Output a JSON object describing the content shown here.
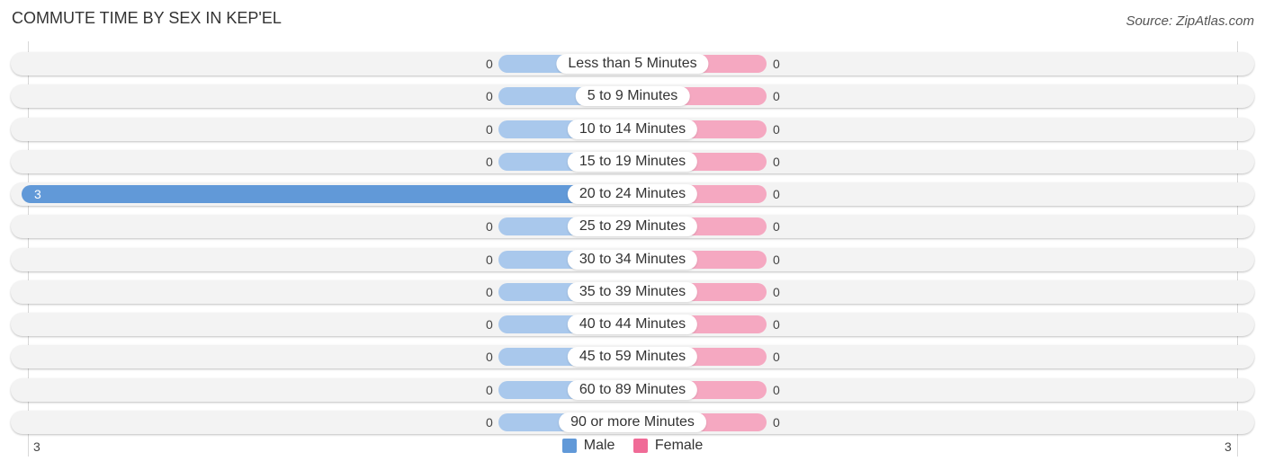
{
  "title": "COMMUTE TIME BY SEX IN KEP'EL",
  "source": "Source: ZipAtlas.com",
  "colors": {
    "male": "#6199d8",
    "male_light": "#a9c8ec",
    "female": "#f06b97",
    "female_light": "#f5a8c1"
  },
  "chart_data": {
    "type": "bar",
    "orientation": "horizontal-diverging",
    "title": "COMMUTE TIME BY SEX IN KEP'EL",
    "categories": [
      "Less than 5 Minutes",
      "5 to 9 Minutes",
      "10 to 14 Minutes",
      "15 to 19 Minutes",
      "20 to 24 Minutes",
      "25 to 29 Minutes",
      "30 to 34 Minutes",
      "35 to 39 Minutes",
      "40 to 44 Minutes",
      "45 to 59 Minutes",
      "60 to 89 Minutes",
      "90 or more Minutes"
    ],
    "series": [
      {
        "name": "Male",
        "values": [
          0,
          0,
          0,
          0,
          3,
          0,
          0,
          0,
          0,
          0,
          0,
          0
        ]
      },
      {
        "name": "Female",
        "values": [
          0,
          0,
          0,
          0,
          0,
          0,
          0,
          0,
          0,
          0,
          0,
          0
        ]
      }
    ],
    "axis": {
      "left_max_label": "3",
      "right_max_label": "3",
      "range": [
        0,
        3
      ]
    },
    "legend": {
      "position": "bottom-center",
      "entries": [
        "Male",
        "Female"
      ]
    },
    "xlabel": "",
    "ylabel": ""
  }
}
